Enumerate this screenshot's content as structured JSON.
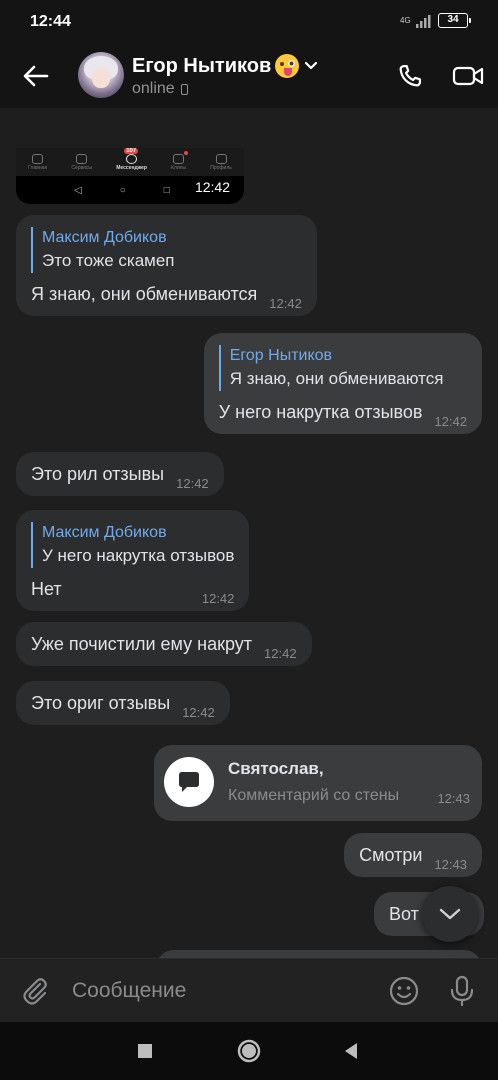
{
  "status_bar": {
    "time": "12:44",
    "network": "4G",
    "battery": "34",
    "icons": [
      "network-4g-icon",
      "signal-icon",
      "battery-icon"
    ]
  },
  "header": {
    "contact_name": "Егор Нытиков",
    "name_emoji": "zany-face-emoji",
    "status": "online",
    "icons": [
      "back-arrow-icon",
      "chevron-down-icon",
      "phone-icon",
      "video-camera-icon"
    ]
  },
  "screenshot_thumb": {
    "tabs": [
      {
        "label": "Главная",
        "icon": "home-icon"
      },
      {
        "label": "Сервисы",
        "icon": "grid-icon"
      },
      {
        "label": "Мессенджер",
        "icon": "chat-icon",
        "badge": "107"
      },
      {
        "label": "Клипы",
        "icon": "clips-icon"
      },
      {
        "label": "Профиль",
        "icon": "profile-icon"
      }
    ],
    "time": "12:42"
  },
  "messages": [
    {
      "direction": "in",
      "reply_author": "Максим Добиков",
      "reply_text": "Это тоже скамеп",
      "text": "Я знаю, они обмениваются",
      "time": "12:42"
    },
    {
      "direction": "out",
      "reply_author": "Егор Нытиков",
      "reply_text": "Я знаю, они обмениваются",
      "text": "У него накрутка отзывов",
      "time": "12:42"
    },
    {
      "direction": "in",
      "text": "Это рил отзывы",
      "time": "12:42"
    },
    {
      "direction": "in",
      "reply_author": "Максим Добиков",
      "reply_text": "У него накрутка отзывов",
      "text": "Нет",
      "time": "12:42"
    },
    {
      "direction": "in",
      "text": "Уже почистили ему накрут",
      "time": "12:42"
    },
    {
      "direction": "in",
      "text": "Это ориг отзывы",
      "time": "12:42"
    },
    {
      "direction": "out",
      "type": "wall_comment",
      "title": "Святослав,",
      "subtitle": "Комментарий со стены",
      "time": "12:43",
      "icon": "comment-icon"
    },
    {
      "direction": "out",
      "text": "Смотри",
      "time": "12:43"
    },
    {
      "direction": "out",
      "text": "Вот",
      "time": ""
    }
  ],
  "composer": {
    "placeholder": "Сообщение",
    "icons": [
      "paperclip-icon",
      "smile-icon",
      "microphone-icon"
    ]
  },
  "colors": {
    "background": "#1e1e1e",
    "bubble_in": "#2c2d2e",
    "bubble_out": "#3b3c3e",
    "accent": "#71aaeb",
    "timestamp": "#8a8b8d"
  }
}
